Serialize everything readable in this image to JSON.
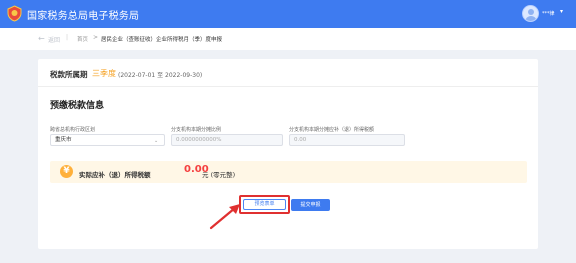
{
  "header": {
    "app_title": "国家税务总局电子税务局",
    "user_name": "***律",
    "user_caret": "▾"
  },
  "breadcrumb": {
    "back_label": "返回",
    "home": "首页",
    "separator": ">",
    "current": "居民企业（查账征收）企业所得税月（季）度申报"
  },
  "period": {
    "label": "税款所属期",
    "value": "三季度",
    "range": "(2022-07-01 至 2022-09-30)"
  },
  "section": {
    "title": "预缴税款信息"
  },
  "fields": [
    {
      "label": "跨省总机构行政区划",
      "value": "重庆市"
    },
    {
      "label": "分支机构本期分摊比例",
      "value": "0.0000000000%"
    },
    {
      "label": "分支机构本期分摊应补（退）所得税额",
      "value": "0.00"
    }
  ],
  "result": {
    "icon_text": "¥",
    "label": "实际应补（退）所得税额",
    "amount": "0.00",
    "unit": "元 (零元整)"
  },
  "actions": {
    "preview": "预览表单",
    "submit": "提交申报"
  },
  "colors": {
    "primary": "#3e7bf0",
    "accent_orange": "#f5a020",
    "amount_red": "#f53f3f",
    "annotation_red": "#e03030"
  }
}
